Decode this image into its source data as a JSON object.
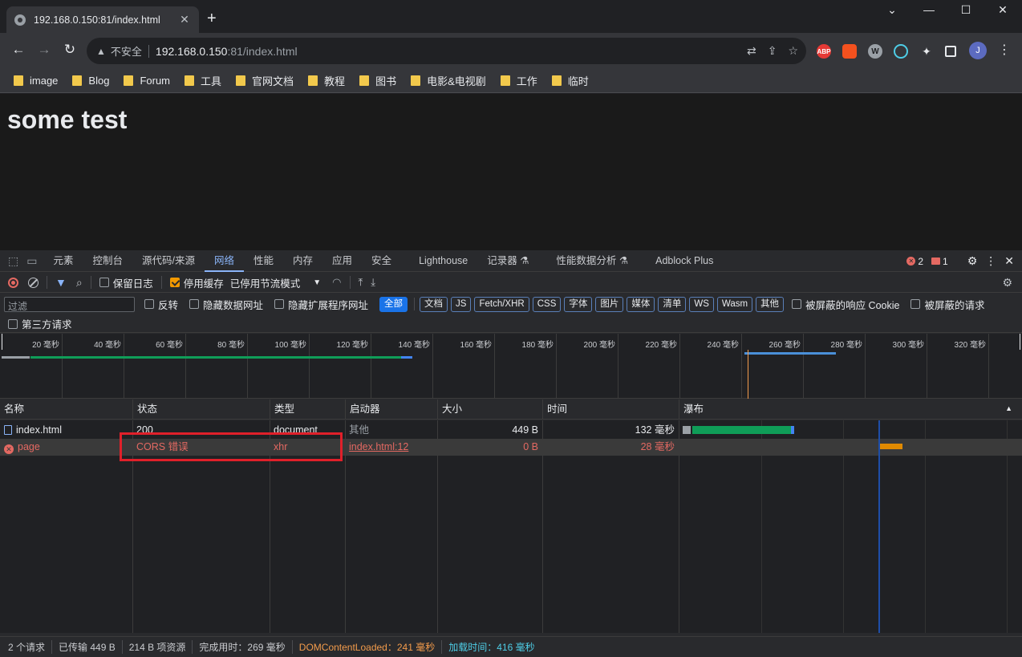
{
  "browser": {
    "tab_title": "192.168.0.150:81/index.html",
    "tab_close": "✕",
    "new_tab": "+",
    "url_host": "192.168.0.150",
    "url_rest": ":81/index.html",
    "security_label": "不安全",
    "profile_initial": "J",
    "extensions": [
      "ABP",
      "W"
    ]
  },
  "bookmarks": [
    "image",
    "Blog",
    "Forum",
    "工具",
    "官网文档",
    "教程",
    "图书",
    "电影&电视剧",
    "工作",
    "临时"
  ],
  "page": {
    "heading": "some test"
  },
  "devtools": {
    "tabs": [
      "元素",
      "控制台",
      "源代码/来源",
      "网络",
      "性能",
      "内存",
      "应用",
      "安全",
      "Lighthouse",
      "记录器 ⚗",
      "性能数据分析 ⚗",
      "Adblock Plus"
    ],
    "active_tab": "网络",
    "error_count": "2",
    "warning_count": "1",
    "toolbar": {
      "preserve_log": "保留日志",
      "disable_cache": "停用缓存",
      "throttle": "已停用节流模式"
    },
    "filter": {
      "placeholder": "过滤",
      "invert": "反转",
      "hide_data_urls": "隐藏数据网址",
      "hide_ext_urls": "隐藏扩展程序网址",
      "types": [
        "全部",
        "文档",
        "JS",
        "Fetch/XHR",
        "CSS",
        "字体",
        "图片",
        "媒体",
        "清单",
        "WS",
        "Wasm",
        "其他"
      ],
      "blocked_cookies": "被屏蔽的响应 Cookie",
      "blocked_requests": "被屏蔽的请求",
      "third_party": "第三方请求"
    },
    "overview_ticks": [
      "20 毫秒",
      "40 毫秒",
      "60 毫秒",
      "80 毫秒",
      "100 毫秒",
      "120 毫秒",
      "140 毫秒",
      "160 毫秒",
      "180 毫秒",
      "200 毫秒",
      "220 毫秒",
      "240 毫秒",
      "260 毫秒",
      "280 毫秒",
      "300 毫秒",
      "320 毫秒"
    ],
    "columns": [
      "名称",
      "状态",
      "类型",
      "启动器",
      "大小",
      "时间",
      "瀑布"
    ],
    "rows": [
      {
        "name": "index.html",
        "status": "200",
        "type": "document",
        "initiator": "其他",
        "size": "449 B",
        "time": "132 毫秒"
      },
      {
        "name": "page",
        "status": "CORS 错误",
        "type": "xhr",
        "initiator": "index.html:12",
        "size": "0 B",
        "time": "28 毫秒"
      }
    ],
    "status_bar": {
      "requests": "2 个请求",
      "transferred": "已传输 449 B",
      "resources": "214 B 项资源",
      "finish": "完成用时：269 毫秒",
      "dcl": "DOMContentLoaded：241 毫秒",
      "load": "加载时间：416 毫秒"
    }
  }
}
